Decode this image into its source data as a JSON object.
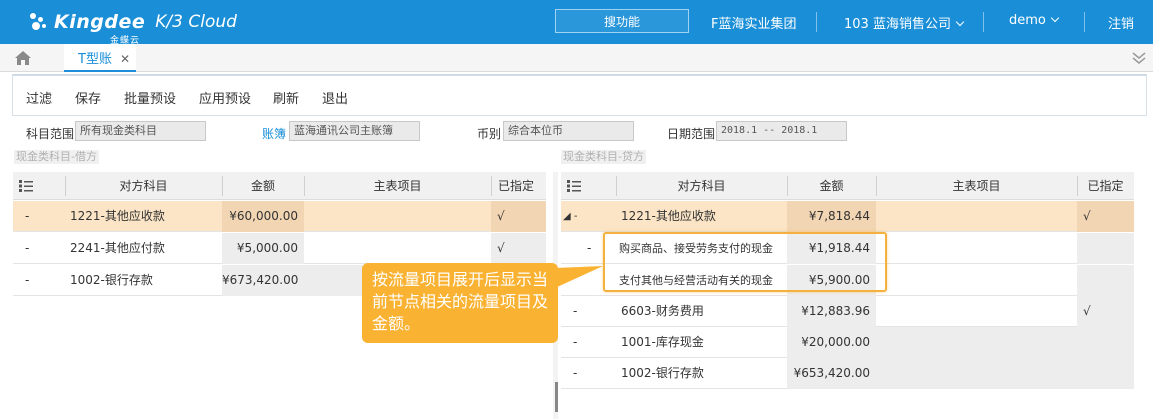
{
  "header": {
    "brand": "Kingdee",
    "brand_sub": "金蝶云",
    "product": "K/3 Cloud",
    "search_label": "搜功能",
    "org_group": "F蓝海实业集团",
    "company": "103 蓝海销售公司",
    "user": "demo",
    "logout": "注销",
    "brand_color": "#1a8fd8"
  },
  "tabs": [
    {
      "label": "T型账",
      "active": true
    }
  ],
  "toolbar": {
    "items": [
      "过滤",
      "保存",
      "批量预设",
      "应用预设",
      "刷新",
      "退出"
    ]
  },
  "filters": {
    "subject_range_label": "科目范围",
    "subject_range_value": "所有现金类科目",
    "ledger_label": "账簿",
    "ledger_value": "蓝海通讯公司主账簿",
    "currency_label": "币别",
    "currency_value": "综合本位币",
    "date_label": "日期范围",
    "date_value": "2018.1 -- 2018.1"
  },
  "debit": {
    "section_title": "现金类科目-借方",
    "columns": [
      "对方科目",
      "金额",
      "主表项目",
      "已指定"
    ],
    "rows": [
      {
        "expander": "-",
        "subject": "1221-其他应收款",
        "amount": "¥60,000.00",
        "item": "",
        "assigned": "√",
        "selected": true
      },
      {
        "expander": "-",
        "subject": "2241-其他应付款",
        "amount": "¥5,000.00",
        "item": "",
        "assigned": "√",
        "selected": false
      },
      {
        "expander": "-",
        "subject": "1002-银行存款",
        "amount": "¥673,420.00",
        "item": "",
        "assigned": "",
        "selected": false
      }
    ]
  },
  "credit": {
    "section_title": "现金类科目-贷方",
    "columns": [
      "对方科目",
      "金额",
      "主表项目",
      "已指定"
    ],
    "rows": [
      {
        "expander": "◢ -",
        "subject": "1221-其他应收款",
        "amount": "¥7,818.44",
        "item": "",
        "assigned": "√",
        "selected": true
      },
      {
        "expander": "-",
        "subject": "购买商品、接受劳务支付的现金",
        "amount": "¥1,918.44",
        "item": "",
        "assigned": "",
        "selected": false,
        "child": true
      },
      {
        "expander": "",
        "subject": "支付其他与经营活动有关的现金",
        "amount": "¥5,900.00",
        "item": "",
        "assigned": "",
        "selected": false,
        "child": true
      },
      {
        "expander": "-",
        "subject": "6603-财务费用",
        "amount": "¥12,883.96",
        "item": "",
        "assigned": "√",
        "selected": false
      },
      {
        "expander": "-",
        "subject": "1001-库存现金",
        "amount": "¥20,000.00",
        "item": "",
        "assigned": "",
        "selected": false
      },
      {
        "expander": "-",
        "subject": "1002-银行存款",
        "amount": "¥653,420.00",
        "item": "",
        "assigned": "",
        "selected": false
      }
    ]
  },
  "callout": {
    "text": "按流量项目展开后显示当前节点相关的流量项目及金额。",
    "color": "#f9b232"
  },
  "icons": {
    "home": "home-icon",
    "close": "close-icon",
    "collapse": "double-chevron-down-icon",
    "column_menu": "column-menu-icon"
  }
}
